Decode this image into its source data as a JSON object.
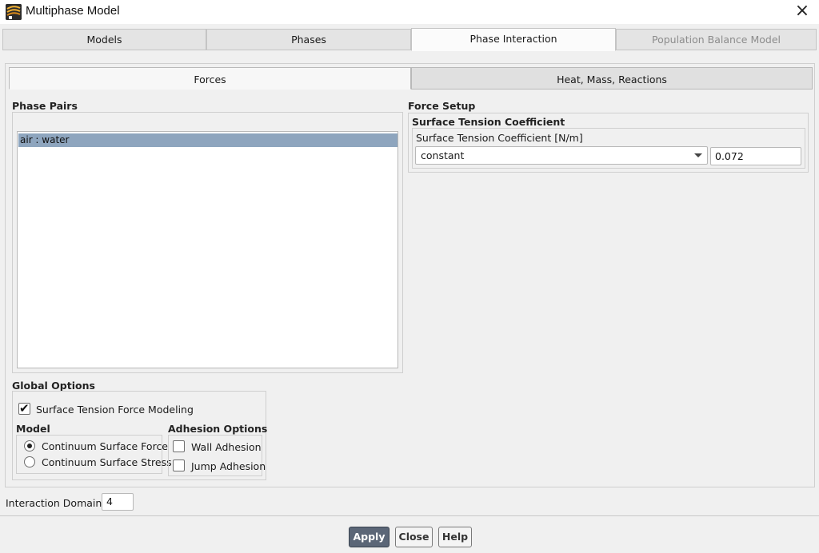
{
  "window": {
    "title": "Multiphase Model",
    "close_icon": "×"
  },
  "tabs": [
    {
      "label": "Models",
      "active": false,
      "disabled": false
    },
    {
      "label": "Phases",
      "active": false,
      "disabled": false
    },
    {
      "label": "Phase Interaction",
      "active": true,
      "disabled": false
    },
    {
      "label": "Population Balance Model",
      "active": false,
      "disabled": true
    }
  ],
  "subtabs": [
    {
      "label": "Forces",
      "active": true
    },
    {
      "label": "Heat, Mass, Reactions",
      "active": false
    }
  ],
  "phase_pairs": {
    "label": "Phase Pairs",
    "items": [
      {
        "label": "air : water",
        "selected": true
      }
    ]
  },
  "force_setup": {
    "label": "Force Setup",
    "surface_tension": {
      "group_label": "Surface Tension Coefficient",
      "field_label": "Surface Tension Coefficient [N/m]",
      "method": "constant",
      "value": "0.072"
    }
  },
  "global_options": {
    "label": "Global Options",
    "surface_tension_modeling": {
      "label": "Surface Tension Force Modeling",
      "checked": true
    },
    "model": {
      "label": "Model",
      "options": [
        {
          "label": "Continuum Surface Force",
          "selected": true
        },
        {
          "label": "Continuum Surface Stress",
          "selected": false
        }
      ]
    },
    "adhesion": {
      "label": "Adhesion Options",
      "options": [
        {
          "label": "Wall Adhesion",
          "checked": false
        },
        {
          "label": "Jump Adhesion",
          "checked": false
        }
      ]
    }
  },
  "interaction_domain": {
    "label": "Interaction Domain ID",
    "value": "4"
  },
  "buttons": {
    "apply": "Apply",
    "close": "Close",
    "help": "Help"
  },
  "colors": {
    "selection": "#8ea5be",
    "primary_button": "#5b6677"
  }
}
